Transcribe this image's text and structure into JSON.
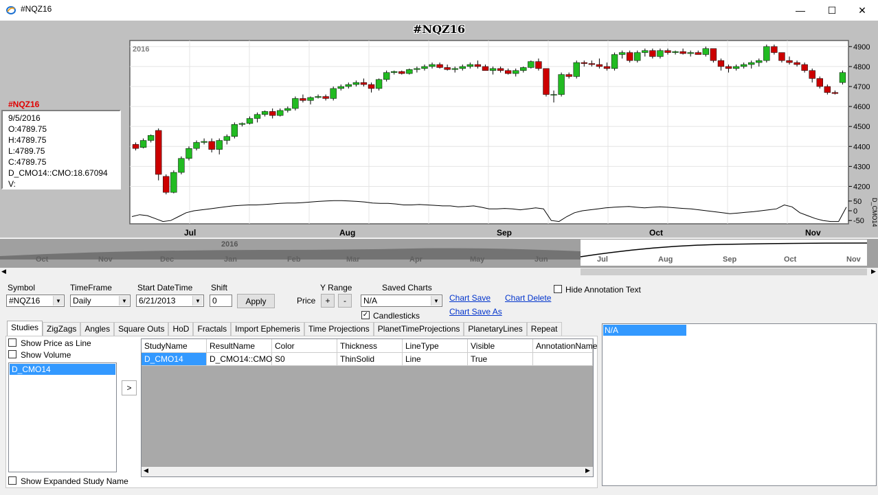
{
  "window": {
    "title": "#NQZ16",
    "minimize": "—",
    "maximize": "☐",
    "close": "✕"
  },
  "chart": {
    "title": "#NQZ16",
    "year_label": "2016",
    "info": {
      "symbol": "#NQZ16",
      "lines": [
        "9/5/2016",
        "O:4789.75",
        "H:4789.75",
        "L:4789.75",
        "C:4789.75",
        "D_CMO14::CMO:18.67094",
        "V:"
      ]
    },
    "price_axis": [
      "4900",
      "4800",
      "4700",
      "4600",
      "4500",
      "4400",
      "4300",
      "4200"
    ],
    "cmo_axis": [
      "50",
      "0",
      "-50"
    ],
    "cmo_axis_label": "D_CMO14",
    "months": [
      "Jul",
      "Aug",
      "Sep",
      "Oct",
      "Nov"
    ],
    "navigator": {
      "year_label": "2016",
      "months": [
        "Oct",
        "Nov",
        "Dec",
        "Jan",
        "Feb",
        "Mar",
        "Apr",
        "May",
        "Jun",
        "Jul",
        "Aug",
        "Sep",
        "Oct",
        "Nov"
      ]
    }
  },
  "chart_data": {
    "type": "candlestick",
    "title": "#NQZ16",
    "ylim": [
      4150,
      4920
    ],
    "up_color": "#22bb22",
    "down_color": "#cc0000",
    "candles": [
      [
        4410,
        4420,
        4380,
        4390
      ],
      [
        4395,
        4440,
        4390,
        4430
      ],
      [
        4430,
        4460,
        4420,
        4455
      ],
      [
        4480,
        4490,
        4230,
        4260
      ],
      [
        4250,
        4260,
        4160,
        4170
      ],
      [
        4170,
        4280,
        4165,
        4270
      ],
      [
        4270,
        4350,
        4260,
        4340
      ],
      [
        4340,
        4400,
        4330,
        4390
      ],
      [
        4390,
        4430,
        4380,
        4420
      ],
      [
        4420,
        4440,
        4410,
        4425
      ],
      [
        4425,
        4440,
        4370,
        4385
      ],
      [
        4385,
        4440,
        4360,
        4430
      ],
      [
        4430,
        4460,
        4410,
        4450
      ],
      [
        4450,
        4520,
        4440,
        4510
      ],
      [
        4510,
        4520,
        4500,
        4515
      ],
      [
        4515,
        4550,
        4510,
        4540
      ],
      [
        4540,
        4570,
        4520,
        4560
      ],
      [
        4560,
        4580,
        4550,
        4575
      ],
      [
        4575,
        4590,
        4540,
        4555
      ],
      [
        4555,
        4590,
        4550,
        4580
      ],
      [
        4580,
        4600,
        4570,
        4590
      ],
      [
        4590,
        4650,
        4580,
        4640
      ],
      [
        4640,
        4660,
        4620,
        4630
      ],
      [
        4630,
        4650,
        4610,
        4645
      ],
      [
        4645,
        4660,
        4640,
        4650
      ],
      [
        4650,
        4660,
        4630,
        4640
      ],
      [
        4640,
        4700,
        4630,
        4690
      ],
      [
        4690,
        4710,
        4680,
        4700
      ],
      [
        4700,
        4720,
        4690,
        4710
      ],
      [
        4710,
        4730,
        4700,
        4720
      ],
      [
        4720,
        4740,
        4700,
        4710
      ],
      [
        4710,
        4720,
        4670,
        4690
      ],
      [
        4690,
        4740,
        4680,
        4735
      ],
      [
        4735,
        4780,
        4725,
        4770
      ],
      [
        4770,
        4780,
        4760,
        4775
      ],
      [
        4775,
        4780,
        4760,
        4765
      ],
      [
        4765,
        4790,
        4760,
        4785
      ],
      [
        4785,
        4800,
        4770,
        4790
      ],
      [
        4790,
        4810,
        4780,
        4800
      ],
      [
        4800,
        4820,
        4790,
        4810
      ],
      [
        4810,
        4820,
        4790,
        4795
      ],
      [
        4795,
        4810,
        4780,
        4785
      ],
      [
        4785,
        4800,
        4770,
        4790
      ],
      [
        4790,
        4810,
        4780,
        4800
      ],
      [
        4800,
        4820,
        4790,
        4810
      ],
      [
        4810,
        4830,
        4790,
        4800
      ],
      [
        4800,
        4810,
        4780,
        4780
      ],
      [
        4780,
        4800,
        4760,
        4790
      ],
      [
        4790,
        4800,
        4770,
        4780
      ],
      [
        4780,
        4790,
        4760,
        4765
      ],
      [
        4765,
        4790,
        4750,
        4780
      ],
      [
        4780,
        4800,
        4770,
        4795
      ],
      [
        4795,
        4830,
        4790,
        4825
      ],
      [
        4825,
        4840,
        4780,
        4790
      ],
      [
        4790,
        4790,
        4650,
        4660
      ],
      [
        4660,
        4680,
        4620,
        4660
      ],
      [
        4660,
        4770,
        4650,
        4760
      ],
      [
        4760,
        4770,
        4740,
        4750
      ],
      [
        4750,
        4830,
        4740,
        4820
      ],
      [
        4820,
        4830,
        4800,
        4815
      ],
      [
        4815,
        4830,
        4800,
        4810
      ],
      [
        4810,
        4840,
        4790,
        4800
      ],
      [
        4800,
        4820,
        4780,
        4790
      ],
      [
        4790,
        4870,
        4780,
        4860
      ],
      [
        4860,
        4880,
        4840,
        4870
      ],
      [
        4870,
        4880,
        4820,
        4830
      ],
      [
        4830,
        4880,
        4820,
        4870
      ],
      [
        4870,
        4890,
        4850,
        4880
      ],
      [
        4880,
        4890,
        4840,
        4850
      ],
      [
        4850,
        4890,
        4840,
        4880
      ],
      [
        4880,
        4890,
        4860,
        4870
      ],
      [
        4870,
        4880,
        4860,
        4875
      ],
      [
        4875,
        4890,
        4860,
        4865
      ],
      [
        4865,
        4880,
        4850,
        4870
      ],
      [
        4870,
        4880,
        4860,
        4860
      ],
      [
        4860,
        4900,
        4850,
        4890
      ],
      [
        4890,
        4890,
        4820,
        4830
      ],
      [
        4830,
        4840,
        4780,
        4800
      ],
      [
        4800,
        4810,
        4770,
        4790
      ],
      [
        4790,
        4810,
        4780,
        4800
      ],
      [
        4800,
        4820,
        4790,
        4810
      ],
      [
        4810,
        4830,
        4790,
        4820
      ],
      [
        4820,
        4840,
        4800,
        4830
      ],
      [
        4830,
        4910,
        4820,
        4900
      ],
      [
        4900,
        4910,
        4860,
        4870
      ],
      [
        4870,
        4870,
        4820,
        4830
      ],
      [
        4830,
        4850,
        4810,
        4820
      ],
      [
        4820,
        4830,
        4800,
        4810
      ],
      [
        4810,
        4820,
        4770,
        4780
      ],
      [
        4780,
        4790,
        4720,
        4740
      ],
      [
        4740,
        4750,
        4690,
        4700
      ],
      [
        4700,
        4710,
        4660,
        4670
      ],
      [
        4670,
        4680,
        4660,
        4665
      ],
      [
        4720,
        4780,
        4710,
        4770
      ]
    ],
    "cmo": [
      -30,
      -20,
      -25,
      -40,
      -55,
      -50,
      -30,
      -10,
      0,
      5,
      10,
      15,
      20,
      25,
      28,
      30,
      30,
      32,
      35,
      38,
      40,
      40,
      42,
      45,
      48,
      50,
      52,
      52,
      50,
      48,
      45,
      40,
      38,
      38,
      35,
      30,
      30,
      32,
      30,
      28,
      25,
      25,
      20,
      22,
      25,
      18,
      10,
      10,
      12,
      10,
      5,
      10,
      15,
      10,
      -50,
      -55,
      -30,
      -10,
      0,
      5,
      10,
      15,
      18,
      20,
      22,
      18,
      15,
      18,
      20,
      18,
      15,
      12,
      10,
      5,
      0,
      -5,
      -10,
      -15,
      -12,
      -8,
      -5,
      0,
      5,
      10,
      30,
      20,
      -10,
      -25,
      -40,
      -50,
      -55,
      -55,
      19
    ]
  },
  "controls": {
    "symbol_label": "Symbol",
    "symbol_value": "#NQZ16",
    "timeframe_label": "TimeFrame",
    "timeframe_value": "Daily",
    "start_label": "Start DateTime",
    "start_value": "6/21/2013",
    "shift_label": "Shift",
    "shift_value": "0",
    "apply": "Apply",
    "yrange_label": "Y Range",
    "price_label": "Price",
    "plus": "+",
    "minus": "-",
    "saved_label": "Saved Charts",
    "saved_value": "N/A",
    "candlesticks_label": "Candlesticks",
    "chart_save": "Chart Save",
    "chart_save_as": "Chart Save As",
    "chart_delete": "Chart Delete",
    "hide_annotation": "Hide Annotation Text"
  },
  "tabs": [
    "Studies",
    "ZigZags",
    "Angles",
    "Square Outs",
    "HoD",
    "Fractals",
    "Import Ephemeris",
    "Time Projections",
    "PlanetTimeProjections",
    "PlanetaryLines",
    "Repeat"
  ],
  "studies": {
    "show_price_line": "Show Price as Line",
    "show_volume": "Show Volume",
    "list": [
      "D_CMO14"
    ],
    "move_button": ">",
    "show_expanded": "Show Expanded Study Name",
    "columns": [
      "StudyName",
      "ResultName",
      "Color",
      "Thickness",
      "LineType",
      "Visible",
      "AnnotationName"
    ],
    "rows": [
      [
        "D_CMO14",
        "D_CMO14::CMO",
        "S0",
        "ThinSolid",
        "Line",
        "True",
        ""
      ]
    ]
  },
  "annotation": {
    "selected": "N/A"
  }
}
